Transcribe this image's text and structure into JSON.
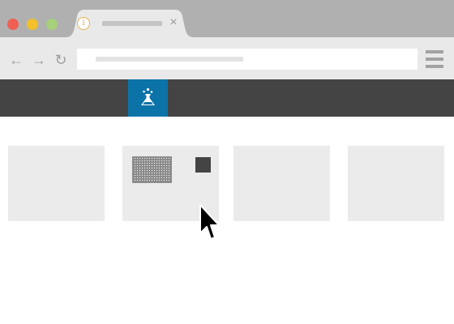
{
  "browser": {
    "window_controls": [
      {
        "name": "close",
        "color": "#f05f53"
      },
      {
        "name": "minimize",
        "color": "#f2c02a"
      },
      {
        "name": "maximize",
        "color": "#a6d07a"
      }
    ],
    "tab": {
      "icon": "info-icon",
      "icon_glyph": "i",
      "close_glyph": "×"
    },
    "toolbar": {
      "back_glyph": "←",
      "forward_glyph": "→",
      "reload_glyph": "↻",
      "menu_icon": "hamburger-menu-icon"
    }
  },
  "app": {
    "header_color": "#444444",
    "logo_icon": "flask-icon",
    "logo_color": "#0b73a8"
  },
  "cards": [
    {
      "content": "empty"
    },
    {
      "content": "grid-thumbnail-and-square"
    },
    {
      "content": "empty"
    },
    {
      "content": "empty"
    }
  ],
  "cursor": {
    "icon": "mouse-pointer-icon"
  }
}
